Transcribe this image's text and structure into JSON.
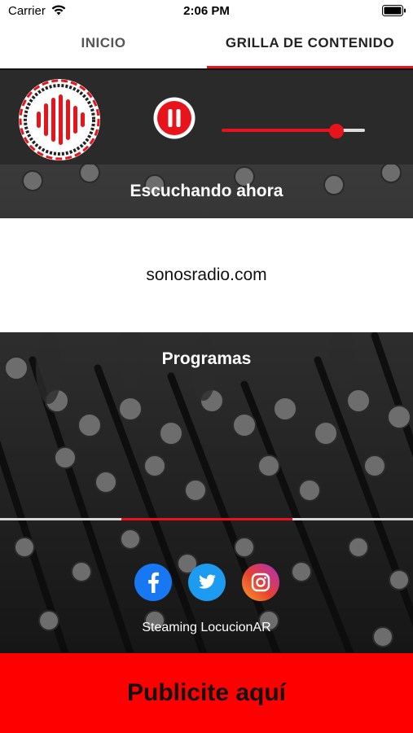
{
  "status_bar": {
    "carrier": "Carrier",
    "time": "2:06 PM"
  },
  "tabs": [
    {
      "label": "INICIO",
      "selected": false
    },
    {
      "label": "GRILLA DE CONTENIDO",
      "selected": true
    }
  ],
  "player": {
    "state": "playing",
    "volume": 0.8
  },
  "now_playing": {
    "header": "Escuchando ahora",
    "station": "sonosradio.com"
  },
  "programs": {
    "header": "Programas"
  },
  "social": {
    "icons": [
      "facebook-icon",
      "twitter-icon",
      "instagram-icon"
    ]
  },
  "footer": {
    "credit": "Steaming LocucionAR"
  },
  "ad": {
    "label": "Publicite aquí"
  },
  "colors": {
    "accent": "#e8141b",
    "ad_background": "#ff0000",
    "player_background": "#2a2a2a"
  }
}
